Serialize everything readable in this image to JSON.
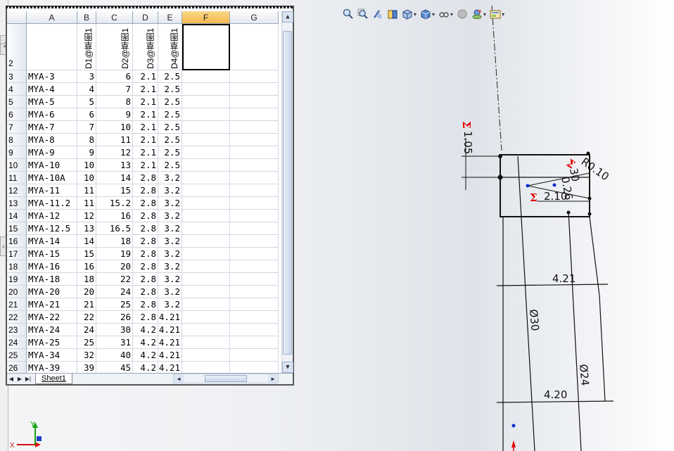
{
  "sheet": {
    "columns": [
      "A",
      "B",
      "C",
      "D",
      "E",
      "F",
      "G"
    ],
    "active_column": "F",
    "header_row_number": "2",
    "param_headers": [
      "D1@草图1",
      "D2@草图1",
      "D3@草图1",
      "D4@草图1"
    ],
    "rows": [
      {
        "n": "3",
        "a": "MYA-3",
        "b": "3",
        "c": "6",
        "d": "2.1",
        "e": "2.5"
      },
      {
        "n": "4",
        "a": "MYA-4",
        "b": "4",
        "c": "7",
        "d": "2.1",
        "e": "2.5"
      },
      {
        "n": "5",
        "a": "MYA-5",
        "b": "5",
        "c": "8",
        "d": "2.1",
        "e": "2.5"
      },
      {
        "n": "6",
        "a": "MYA-6",
        "b": "6",
        "c": "9",
        "d": "2.1",
        "e": "2.5"
      },
      {
        "n": "7",
        "a": "MYA-7",
        "b": "7",
        "c": "10",
        "d": "2.1",
        "e": "2.5"
      },
      {
        "n": "8",
        "a": "MYA-8",
        "b": "8",
        "c": "11",
        "d": "2.1",
        "e": "2.5"
      },
      {
        "n": "9",
        "a": "MYA-9",
        "b": "9",
        "c": "12",
        "d": "2.1",
        "e": "2.5"
      },
      {
        "n": "10",
        "a": "MYA-10",
        "b": "10",
        "c": "13",
        "d": "2.1",
        "e": "2.5"
      },
      {
        "n": "11",
        "a": "MYA-10A",
        "b": "10",
        "c": "14",
        "d": "2.8",
        "e": "3.2"
      },
      {
        "n": "12",
        "a": "MYA-11",
        "b": "11",
        "c": "15",
        "d": "2.8",
        "e": "3.2"
      },
      {
        "n": "13",
        "a": "MYA-11.2",
        "b": "11",
        "c": "15.2",
        "d": "2.8",
        "e": "3.2"
      },
      {
        "n": "14",
        "a": "MYA-12",
        "b": "12",
        "c": "16",
        "d": "2.8",
        "e": "3.2"
      },
      {
        "n": "15",
        "a": "MYA-12.5",
        "b": "13",
        "c": "16.5",
        "d": "2.8",
        "e": "3.2"
      },
      {
        "n": "16",
        "a": "MYA-14",
        "b": "14",
        "c": "18",
        "d": "2.8",
        "e": "3.2"
      },
      {
        "n": "17",
        "a": "MYA-15",
        "b": "15",
        "c": "19",
        "d": "2.8",
        "e": "3.2"
      },
      {
        "n": "18",
        "a": "MYA-16",
        "b": "16",
        "c": "20",
        "d": "2.8",
        "e": "3.2"
      },
      {
        "n": "19",
        "a": "MYA-18",
        "b": "18",
        "c": "22",
        "d": "2.8",
        "e": "3.2"
      },
      {
        "n": "20",
        "a": "MYA-20",
        "b": "20",
        "c": "24",
        "d": "2.8",
        "e": "3.2"
      },
      {
        "n": "21",
        "a": "MYA-21",
        "b": "21",
        "c": "25",
        "d": "2.8",
        "e": "3.2"
      },
      {
        "n": "22",
        "a": "MYA-22",
        "b": "22",
        "c": "26",
        "d": "2.8",
        "e": "4.21"
      },
      {
        "n": "23",
        "a": "MYA-24",
        "b": "24",
        "c": "30",
        "d": "4.2",
        "e": "4.21"
      },
      {
        "n": "24",
        "a": "MYA-25",
        "b": "25",
        "c": "31",
        "d": "4.2",
        "e": "4.21"
      },
      {
        "n": "25",
        "a": "MYA-34",
        "b": "32",
        "c": "40",
        "d": "4.2",
        "e": "4.21"
      },
      {
        "n": "26",
        "a": "MYA-39",
        "b": "39",
        "c": "45",
        "d": "4.2",
        "e": "4.21"
      }
    ],
    "tab_label": "Sheet1"
  },
  "sketch": {
    "dims": {
      "d105": "1.05",
      "r010": "R0.10",
      "d210": "2.10",
      "d026": "0.26",
      "d421": "4.21",
      "d30": "Ø30",
      "d24": "Ø24",
      "d420": "4.20",
      "angle": "30"
    },
    "sigma": "Σ"
  },
  "toolbar": {
    "icons": [
      "zoom-to-fit-icon",
      "zoom-area-icon",
      "previous-view-icon",
      "section-view-icon",
      "view-orientation-icon",
      "display-style-icon",
      "hide-show-icon",
      "edit-appearance-icon",
      "apply-scene-icon",
      "view-settings-icon"
    ]
  },
  "triad": {
    "x_label": "X",
    "y_label": "Y"
  },
  "colors": {
    "accent_red": "#e00000",
    "selection_blue": "#0b2fd6",
    "header_orange": "#f3b84c"
  }
}
